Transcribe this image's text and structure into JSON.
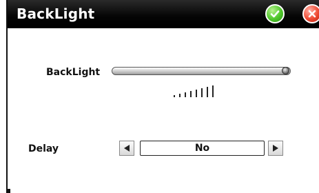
{
  "window": {
    "title": "BackLight",
    "ok_icon": "check-icon",
    "close_icon": "close-icon",
    "ok_color": "#3fbf1f",
    "close_color": "#e03a24"
  },
  "backlight": {
    "label": "BackLight",
    "level_fraction": 0.98,
    "level_indicator_bars": 8
  },
  "delay": {
    "label": "Delay",
    "value": "No",
    "prev_icon": "triangle-left-icon",
    "next_icon": "triangle-right-icon"
  }
}
